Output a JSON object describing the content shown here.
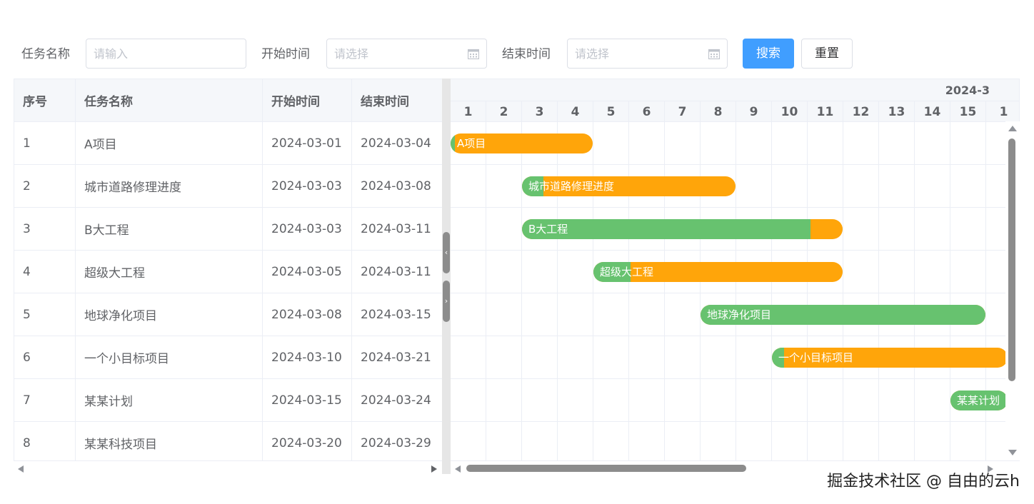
{
  "search_form": {
    "task_name_label": "任务名称",
    "task_name_placeholder": "请输入",
    "start_time_label": "开始时间",
    "start_time_placeholder": "请选择",
    "end_time_label": "结束时间",
    "end_time_placeholder": "请选择",
    "search_button": "搜索",
    "reset_button": "重置"
  },
  "table": {
    "columns": [
      "序号",
      "任务名称",
      "开始时间",
      "结束时间"
    ],
    "rows": [
      {
        "index": "1",
        "name": "A项目",
        "start": "2024-03-01",
        "end": "2024-03-04"
      },
      {
        "index": "2",
        "name": "城市道路修理进度",
        "start": "2024-03-03",
        "end": "2024-03-08"
      },
      {
        "index": "3",
        "name": "B大工程",
        "start": "2024-03-03",
        "end": "2024-03-11"
      },
      {
        "index": "4",
        "name": "超级大工程",
        "start": "2024-03-05",
        "end": "2024-03-11"
      },
      {
        "index": "5",
        "name": "地球净化项目",
        "start": "2024-03-08",
        "end": "2024-03-15"
      },
      {
        "index": "6",
        "name": "一个小目标项目",
        "start": "2024-03-10",
        "end": "2024-03-21"
      },
      {
        "index": "7",
        "name": "某某计划",
        "start": "2024-03-15",
        "end": "2024-03-24"
      },
      {
        "index": "8",
        "name": "某某科技项目",
        "start": "2024-03-20",
        "end": "2024-03-29"
      }
    ]
  },
  "gantt": {
    "month": "2024-3",
    "days": [
      "1",
      "2",
      "3",
      "4",
      "5",
      "6",
      "7",
      "8",
      "9",
      "10",
      "11",
      "12",
      "13",
      "14",
      "15",
      "1"
    ],
    "bars": [
      {
        "label": "A项目",
        "progress": 0.03
      },
      {
        "label": "城市道路修理进度",
        "progress": 0.1
      },
      {
        "label": "B大工程",
        "progress": 0.9
      },
      {
        "label": "超级大工程",
        "progress": 0.15
      },
      {
        "label": "地球净化项目",
        "progress": 1.0
      },
      {
        "label": "一个小目标项目",
        "progress": 0.05
      },
      {
        "label": "某某计划",
        "progress": 1.0
      },
      {
        "label": "",
        "progress": 0
      }
    ],
    "colors": {
      "progress": "#67c26f",
      "remaining": "#ffa50a"
    }
  },
  "splitter": {
    "collapse_glyph": "‹",
    "expand_glyph": "›"
  },
  "watermark": "掘金技术社区 @ 自由的云h",
  "colors": {
    "primary": "#409eff",
    "border": "#dcdfe6"
  }
}
